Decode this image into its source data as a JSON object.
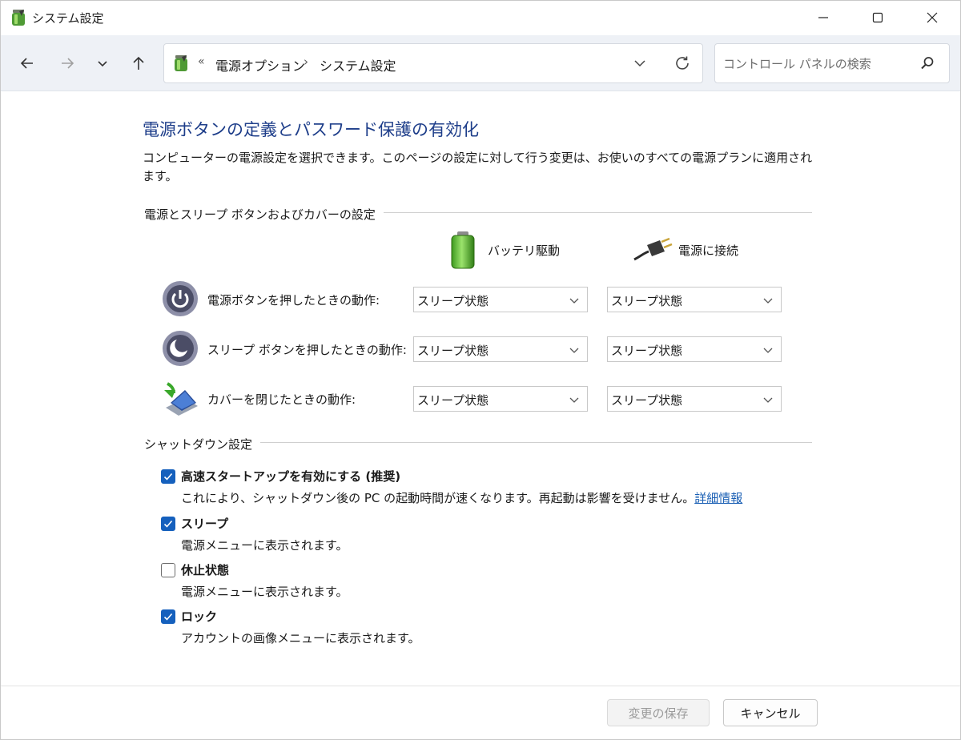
{
  "window": {
    "title": "システム設定"
  },
  "nav": {
    "breadcrumb_prefix": "«",
    "breadcrumb": [
      "電源オプション",
      "システム設定"
    ],
    "breadcrumb_separator": "›",
    "search_placeholder": "コントロール パネルの検索"
  },
  "main": {
    "heading": "電源ボタンの定義とパスワード保護の有効化",
    "description": "コンピューターの電源設定を選択できます。このページの設定に対して行う変更は、お使いのすべての電源プランに適用されます。",
    "power_group": {
      "title": "電源とスリープ ボタンおよびカバーの設定",
      "col_battery": "バッテリ駆動",
      "col_plugged": "電源に接続",
      "rows": [
        {
          "label": "電源ボタンを押したときの動作:",
          "battery": "スリープ状態",
          "plugged": "スリープ状態"
        },
        {
          "label": "スリープ ボタンを押したときの動作:",
          "battery": "スリープ状態",
          "plugged": "スリープ状態"
        },
        {
          "label": "カバーを閉じたときの動作:",
          "battery": "スリープ状態",
          "plugged": "スリープ状態"
        }
      ]
    },
    "shutdown_group": {
      "title": "シャットダウン設定",
      "items": [
        {
          "label": "高速スタートアップを有効にする (推奨)",
          "checked": true,
          "desc": "これにより、シャットダウン後の PC の起動時間が速くなります。再起動は影響を受けません。",
          "link": "詳細情報"
        },
        {
          "label": "スリープ",
          "checked": true,
          "desc": "電源メニューに表示されます。"
        },
        {
          "label": "休止状態",
          "checked": false,
          "desc": "電源メニューに表示されます。"
        },
        {
          "label": "ロック",
          "checked": true,
          "desc": "アカウントの画像メニューに表示されます。"
        }
      ]
    }
  },
  "footer": {
    "save_label": "変更の保存",
    "cancel_label": "キャンセル"
  },
  "colors": {
    "heading": "#1e3e8a",
    "checkbox_accent": "#1560bd",
    "link": "#1a5fb4",
    "navbar_bg": "#eef1f6"
  }
}
